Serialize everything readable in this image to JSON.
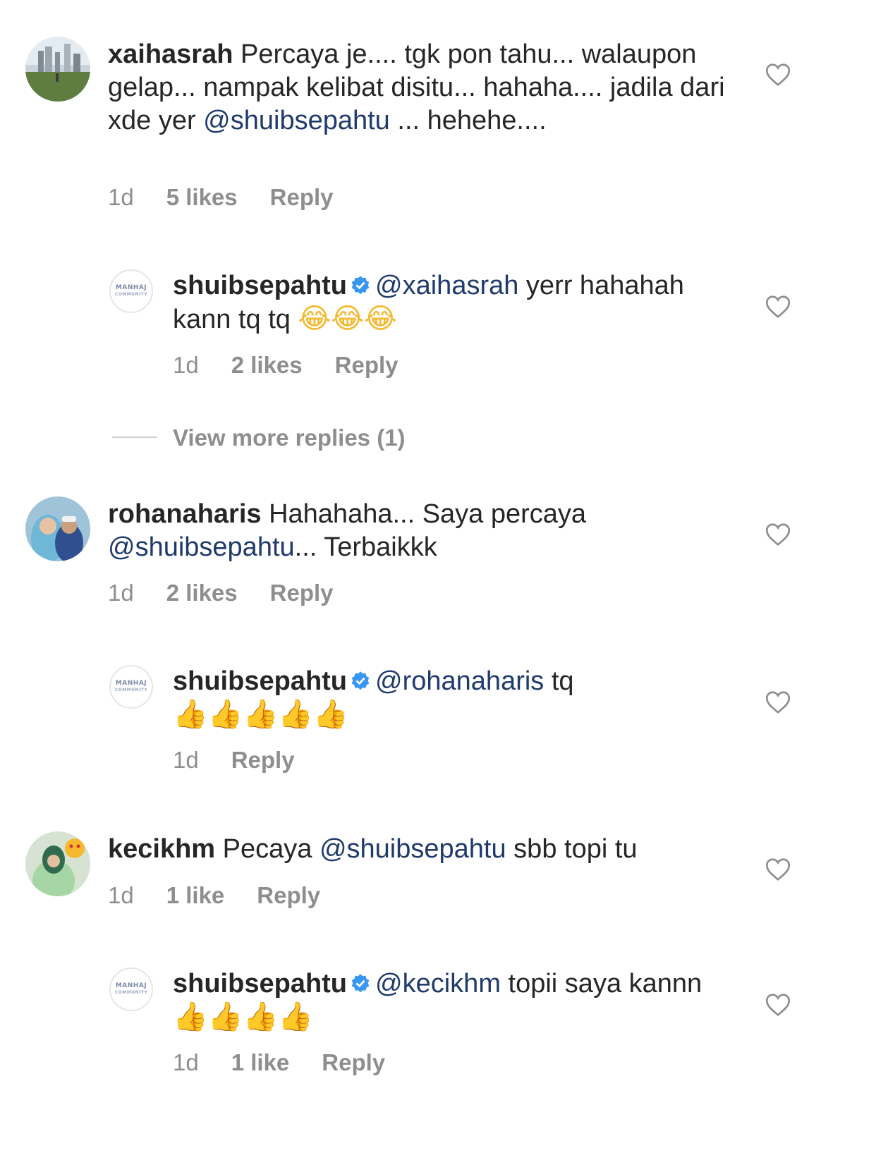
{
  "comments": [
    {
      "username": "xaihasrah",
      "text_before": " Percaya je.... tgk pon tahu... walaupon gelap... nampak kelibat disitu... hahaha.... jadila dari xde yer ",
      "mention": "@shuibsepahtu",
      "text_after": " ... hehehe....",
      "time": "1d",
      "likes": "5 likes",
      "reply": "Reply"
    },
    {
      "username": "shuibsepahtu",
      "verified": true,
      "mention": "@xaihasrah",
      "text_after": " yerr hahahah kann tq tq ",
      "emoji": "😂😂😂",
      "time": "1d",
      "likes": "2 likes",
      "reply": "Reply"
    },
    {
      "view_more": "View more replies (1)"
    },
    {
      "username": "rohanaharis",
      "text_before": " Hahahaha... Saya percaya ",
      "mention": "@shuibsepahtu",
      "text_after": "... Terbaikkk",
      "time": "1d",
      "likes": "2 likes",
      "reply": "Reply"
    },
    {
      "username": "shuibsepahtu",
      "verified": true,
      "mention": "@rohanaharis",
      "text_after": " tq ",
      "emoji": "👍👍👍👍👍",
      "time": "1d",
      "reply": "Reply"
    },
    {
      "username": "kecikhm",
      "text_before": " Pecaya ",
      "mention": "@shuibsepahtu",
      "text_after": "  sbb topi tu",
      "time": "1d",
      "likes": "1 like",
      "reply": "Reply"
    },
    {
      "username": "shuibsepahtu",
      "verified": true,
      "mention": "@kecikhm",
      "text_after": " topii saya kannn ",
      "emoji": "👍👍👍👍",
      "time": "1d",
      "likes": "1 like",
      "reply": "Reply"
    }
  ],
  "avatar_logo": {
    "line1": "MANHAJ",
    "line2": "COMMUNITY"
  },
  "colors": {
    "mention": "#1f3a6b",
    "meta": "#8e8e8e",
    "verified": "#3897f0",
    "heart": "#8e8e8e"
  },
  "icons": {
    "like": "heart-outline-icon",
    "verified": "verified-badge-icon"
  }
}
